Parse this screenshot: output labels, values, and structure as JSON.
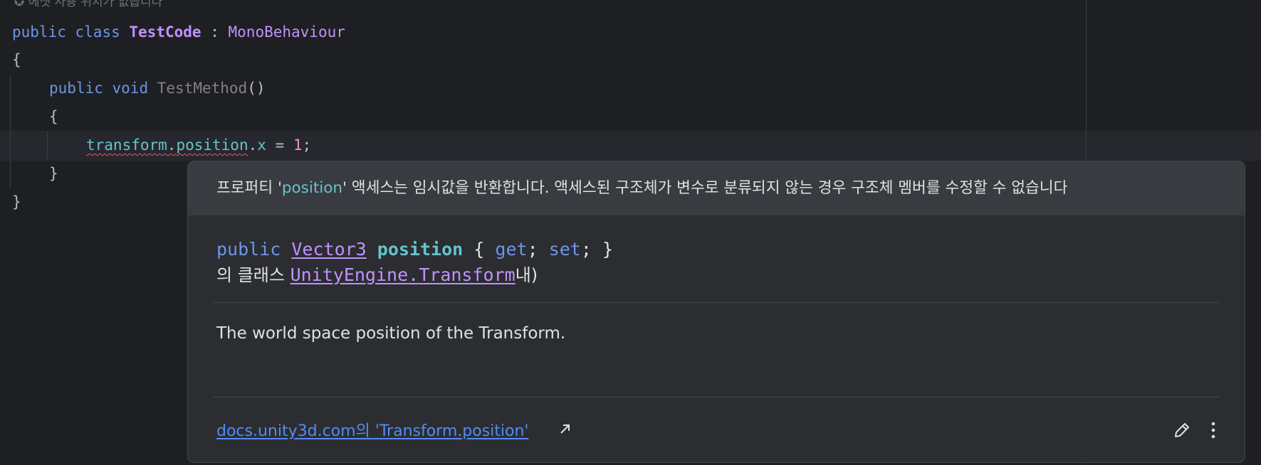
{
  "editor": {
    "usage_hint_icon": "unity-icon",
    "usage_hint": "에셋 사용 위치가 없습니다",
    "code": {
      "l1_kw1": "public",
      "l1_kw2": "class",
      "l1_class": "TestCode",
      "l1_colon": ":",
      "l1_base": "MonoBehaviour",
      "l2": "{",
      "l3_kw1": "public",
      "l3_kw2": "void",
      "l3_method": "TestMethod",
      "l3_parens": "()",
      "l4": "{",
      "l5_obj": "transform",
      "l5_dot1": ".",
      "l5_prop": "position",
      "l5_dot2": ".",
      "l5_field": "x",
      "l5_eq": " = ",
      "l5_num": "1",
      "l5_semi": ";",
      "l6": "}",
      "l7": "}"
    }
  },
  "popup": {
    "error_pre": "프로퍼티 '",
    "error_name": "position",
    "error_post": "' 액세스는 임시값을 반환합니다. 액세스된 구조체가 변수로 분류되지 않는 경우 구조체 멤버를 수정할 수 없습니다",
    "sig_kw": "public",
    "sig_type": "Vector3",
    "sig_name": "position",
    "sig_open": "{",
    "sig_get": "get",
    "sig_semi1": ";",
    "sig_set": "set",
    "sig_semi2": ";",
    "sig_close": "}",
    "owner_prefix": "의 클래스 ",
    "owner_ns": "UnityEngine",
    "owner_dot": ".",
    "owner_class": "Transform",
    "owner_suffix": "내)",
    "description": "The world space position of the Transform.",
    "doc_link": "docs.unity3d.com의 'Transform.position'",
    "ext_icon": "arrow-up-right-icon",
    "edit_icon": "pencil-icon",
    "more_icon": "more-vertical-icon"
  },
  "colors": {
    "background": "#1e1f22",
    "keyword": "#6c95eb",
    "class": "#c191ff",
    "field": "#66c3cc",
    "number": "#ed94c0",
    "link": "#548af7",
    "error_underline": "#e55a5a"
  }
}
